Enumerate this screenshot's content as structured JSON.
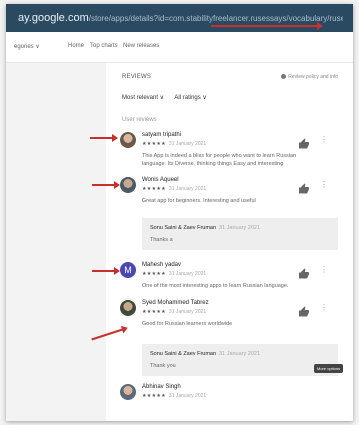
{
  "browser": {
    "url_main": "ay.google.com",
    "url_path": "/store/apps/details?id=com.stabilityfreelancer.rusessays/vocabulary/rusevetoCurrent&showAllReviews=true"
  },
  "nav": {
    "categories": "egories ∨",
    "home": "Home",
    "top_charts": "Top charts",
    "new_releases": "New releases"
  },
  "reviews_panel": {
    "heading": "REVIEWS",
    "review_policy": "Review policy and info",
    "sort_label": "Most relevant ∨",
    "rating_filter": "All ratings ∨",
    "section_label": "User reviews",
    "stars": "★★★★★",
    "thumb_icon": "thumbs-up-icon",
    "more_icon": "more-vert-icon",
    "tooltip": "More options",
    "accent_color": "#4a47b0",
    "arrow_color": "#c9302c",
    "reviews": [
      {
        "name": "satyam tripathi",
        "date": "31 January 2021",
        "text": "This App is indeed a bliss for people who want to learn Russian language. Its Diverse, thinking things Easy and interesting"
      },
      {
        "name": "Wonis Aqueel",
        "date": "31 January 2021",
        "text": "Great app for beginners. Interesting and useful",
        "reply": {
          "name": "Sonu Saini & Zaev Fruman",
          "date": "31 January 2021",
          "text": "Thanks a"
        }
      },
      {
        "name": "Mahesh yadav",
        "initial": "M",
        "date": "31 January 2021",
        "text": "One of the most interesting apps to learn Russian language."
      },
      {
        "name": "Syed Mohammed Tabrez",
        "date": "31 January 2021",
        "text": "Good for Russian learners worldwide",
        "reply": {
          "name": "Sonu Saini & Zaev Fruman",
          "date": "31 January 2021",
          "text": "Thank you"
        }
      },
      {
        "name": "Abhinav Singh",
        "date": "31 January 2021",
        "text": ""
      }
    ]
  }
}
